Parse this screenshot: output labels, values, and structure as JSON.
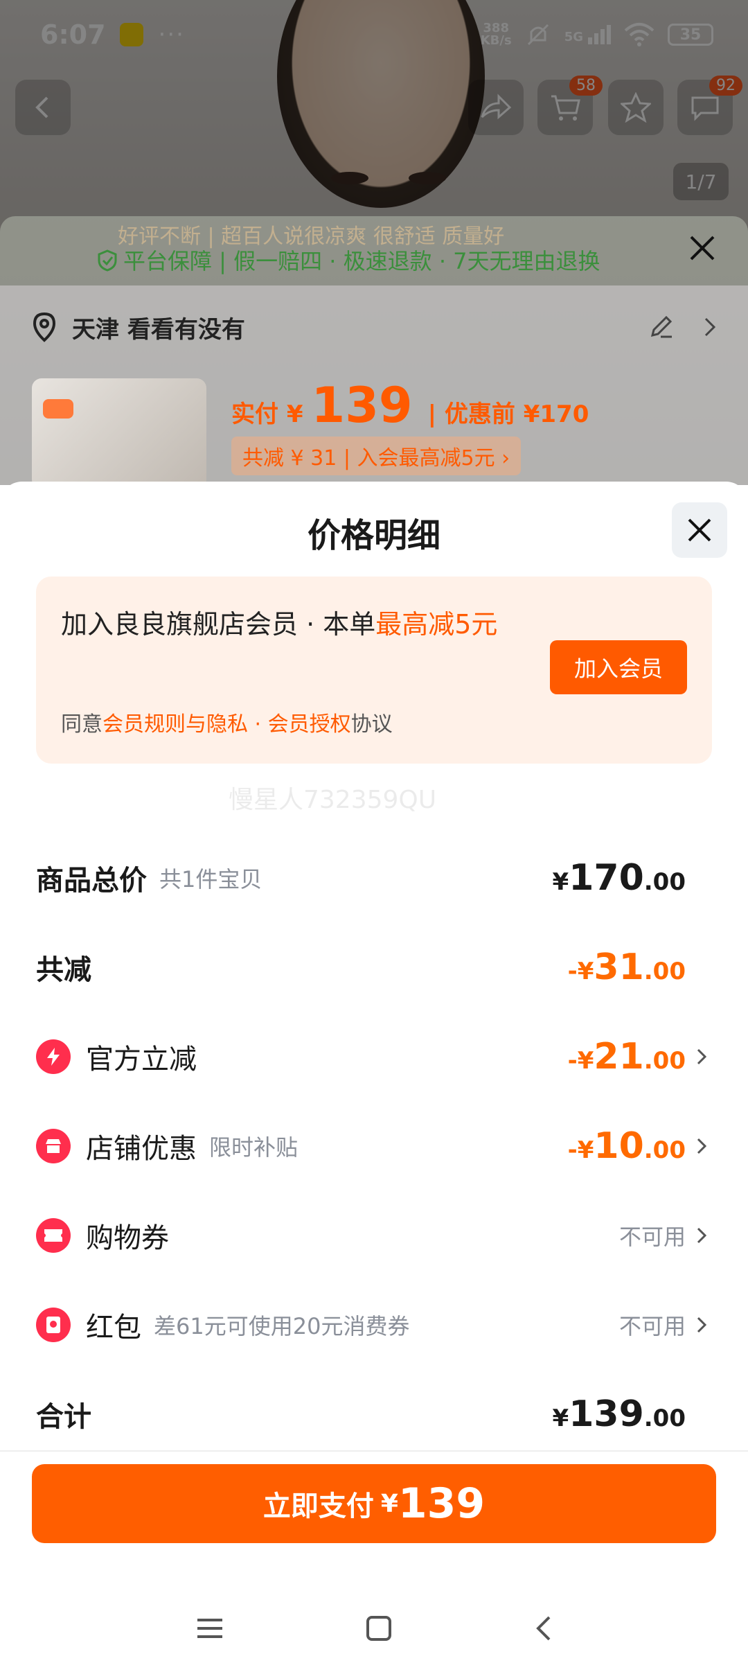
{
  "status_bar": {
    "time": "6:07",
    "dots": "···",
    "net_speed_top": "388",
    "net_speed_bottom": "KB/s",
    "network": "5G",
    "battery": "35"
  },
  "product_page": {
    "cart_badge": "58",
    "message_badge": "92",
    "image_pager": "1/7",
    "review_ticker": "好评不断 | 超百人说很凉爽 很舒适 质量好",
    "assurance_text": "平台保障 | 假一赔四 · 极速退款 · 7天无理由退换",
    "location_text": "天津 看看有没有",
    "price_label": "实付 ¥",
    "price_value": "139",
    "price_before": "| 优惠前 ¥170",
    "coupon_text": "共减 ¥ 31 | 入会最高减5元 ›"
  },
  "sheet": {
    "title": "价格明细",
    "member": {
      "text_prefix": "加入良良旗舰店会员 · 本单",
      "text_highlight": "最高减5元",
      "agree_prefix": "同意",
      "rules_link": "会员规则与隐私",
      "dot": " · ",
      "auth_link": "会员授权",
      "agree_suffix": "协议",
      "join_button": "加入会员"
    },
    "watermark": "慢星人732359QU",
    "rows": {
      "total": {
        "label": "商品总价",
        "sub": "共1件宝贝",
        "yen": "¥",
        "int": "170",
        "dec": ".00"
      },
      "reduce": {
        "label": "共减",
        "yen": "-¥",
        "int": "31",
        "dec": ".00"
      },
      "official": {
        "label": "官方立减",
        "yen": "-¥",
        "int": "21",
        "dec": ".00"
      },
      "store": {
        "label": "店铺优惠",
        "sub": "限时补贴",
        "yen": "-¥",
        "int": "10",
        "dec": ".00"
      },
      "voucher": {
        "label": "购物券",
        "status": "不可用"
      },
      "redpacket": {
        "label": "红包",
        "sub": "差61元可使用20元消费券",
        "status": "不可用"
      },
      "sum": {
        "label": "合计",
        "yen": "¥",
        "int": "139",
        "dec": ".00"
      }
    },
    "pay_button": {
      "label": "立即支付",
      "yen": "¥",
      "amount": "139"
    }
  },
  "colors": {
    "accent": "#ff5e00",
    "amount_orange": "#ff6a00",
    "icon_red": "#ff2e4d",
    "member_bg": "#fff1e8",
    "assurance_green": "#3b8f3c"
  }
}
